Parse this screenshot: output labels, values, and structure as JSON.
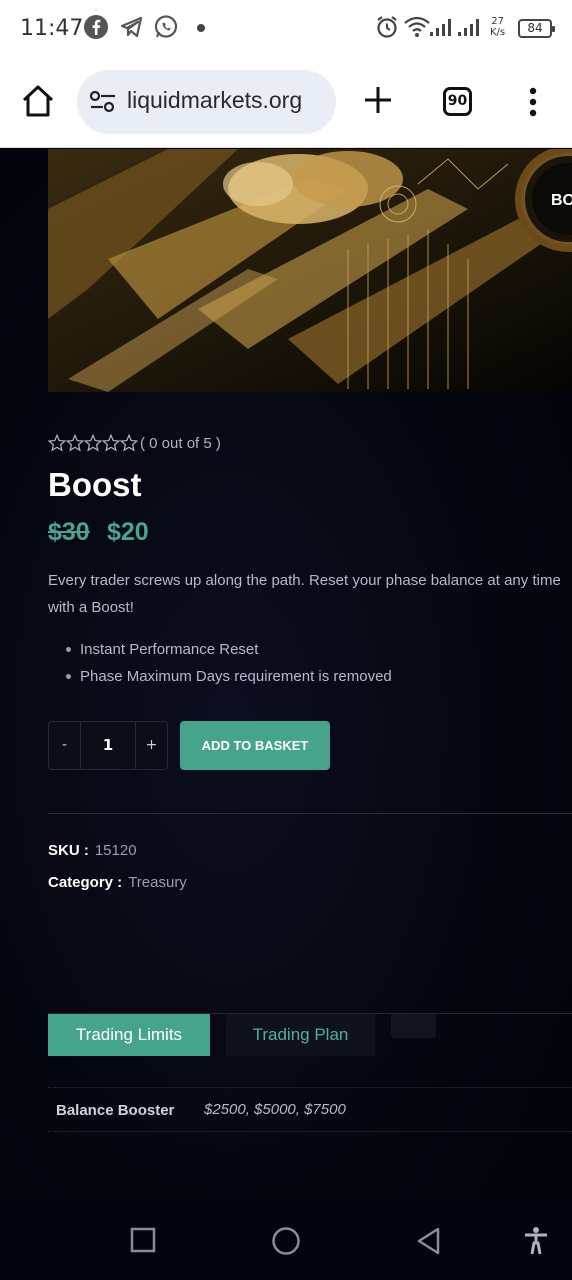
{
  "status_bar": {
    "time": "11:47",
    "speed_value": "27",
    "speed_unit": "K/s",
    "battery": "84",
    "icons": [
      "facebook-icon",
      "telegram-icon",
      "whatsapp-icon",
      "alarm-icon",
      "wifi-icon",
      "signal-icon"
    ]
  },
  "browser": {
    "url": "liquidmarkets.org",
    "tab_count": "90"
  },
  "product": {
    "rating_text": "( 0 out of 5 )",
    "rating": 0,
    "rating_max": 5,
    "title": "Boost",
    "price_old": "$30",
    "price_new": "$20",
    "description": "Every trader screws up along the path. Reset your phase balance at any time with a Boost!",
    "features": [
      "Instant Performance Reset",
      "Phase Maximum Days requirement is removed"
    ],
    "quantity": "1",
    "minus_label": "-",
    "plus_label": "+",
    "add_to_basket": "ADD TO BASKET",
    "sku_label": "SKU :",
    "sku_value": "15120",
    "category_label": "Category :",
    "category_value": "Treasury",
    "hero_badge": "BO"
  },
  "tabs": [
    {
      "label": "Trading Limits",
      "active": true
    },
    {
      "label": "Trading Plan",
      "active": false
    }
  ],
  "limits_table": [
    {
      "key": "Balance Booster",
      "value": "$2500, $5000, $7500"
    }
  ],
  "colors": {
    "accent": "#46a48d",
    "background": "#03040e"
  }
}
